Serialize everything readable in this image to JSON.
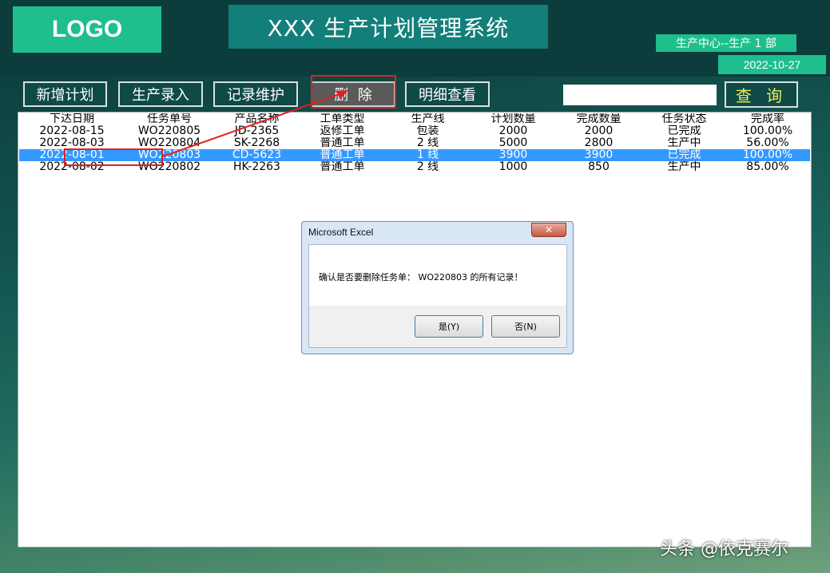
{
  "header": {
    "logo": "LOGO",
    "title": "XXX 生产计划管理系统",
    "department": "生产中心--生产 1 部",
    "date": "2022-10-27"
  },
  "toolbar": {
    "add_plan": "新增计划",
    "production_entry": "生产录入",
    "record_maintenance": "记录维护",
    "delete": "删  除",
    "detail_view": "明细查看",
    "search_value": "",
    "query": "查 询"
  },
  "table": {
    "columns": [
      "下达日期",
      "任务单号",
      "产品名称",
      "工单类型",
      "生产线",
      "计划数量",
      "完成数量",
      "任务状态",
      "完成率"
    ],
    "rows": [
      [
        "2022-08-15",
        "WO220805",
        "JD-2365",
        "返修工单",
        "包装",
        "2000",
        "2000",
        "已完成",
        "100.00%"
      ],
      [
        "2022-08-03",
        "WO220804",
        "SK-2268",
        "普通工单",
        "2 线",
        "5000",
        "2800",
        "生产中",
        "56.00%"
      ],
      [
        "2022-08-01",
        "WO220803",
        "CD-5623",
        "普通工单",
        "1 线",
        "3900",
        "3900",
        "已完成",
        "100.00%"
      ],
      [
        "2022-08-02",
        "WO220802",
        "HK-2263",
        "普通工单",
        "2 线",
        "1000",
        "850",
        "生产中",
        "85.00%"
      ]
    ],
    "selected_row": 2
  },
  "dialog": {
    "title": "Microsoft Excel",
    "close": "✕",
    "message": "确认是否要删除任务单： WO220803 的所有记录！",
    "yes": "是(Y)",
    "no": "否(N)"
  },
  "watermark": "头条 @依克赛尔",
  "colors": {
    "accent": "#1fbf8d",
    "title_bg": "#127f7a",
    "selection": "#3399ff",
    "annotation": "#e02020"
  }
}
